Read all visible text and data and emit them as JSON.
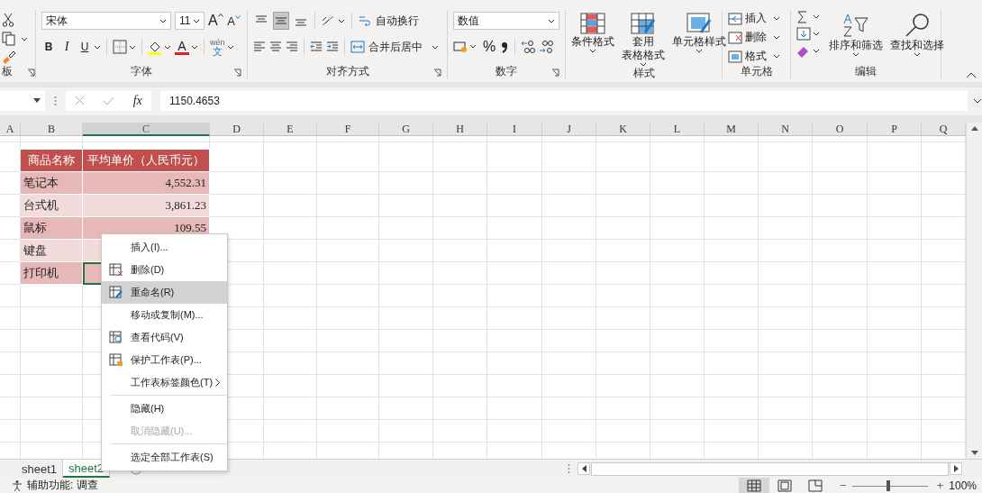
{
  "ribbon": {
    "clipboard": {
      "label": "板",
      "launcher": true
    },
    "font": {
      "label": "字体",
      "launcher": true,
      "font_name": "宋体",
      "font_size": "11",
      "grow": "A",
      "shrink": "A",
      "bold": "B",
      "italic": "I",
      "underline": "U",
      "font_color": "A",
      "phonetic_top": "wén",
      "phonetic_bottom": "文"
    },
    "alignment": {
      "label": "对齐方式",
      "launcher": true,
      "wrap_text": "自动换行",
      "merge_center": "合并后居中",
      "vertical": [
        {
          "selected": false
        },
        {
          "selected": true
        },
        {
          "selected": false
        }
      ]
    },
    "number": {
      "label": "数字",
      "launcher": true,
      "format": "数值",
      "percent": "%"
    },
    "styles": {
      "label": "样式",
      "buttons": [
        {
          "lines": [
            "条件格式"
          ]
        },
        {
          "lines": [
            "套用",
            "表格格式"
          ]
        },
        {
          "lines": [
            "单元格样式"
          ]
        }
      ]
    },
    "cells": {
      "label": "单元格",
      "buttons": [
        {
          "label": "插入"
        },
        {
          "label": "删除"
        },
        {
          "label": "格式"
        }
      ]
    },
    "editing": {
      "label": "编辑",
      "buttons": [
        {
          "label": "排序和筛选"
        },
        {
          "label": "查找和选择"
        }
      ]
    }
  },
  "formula_bar": {
    "fx": "fx",
    "value": "1150.4653"
  },
  "sheet": {
    "columns": [
      {
        "label": "A",
        "selected": false
      },
      {
        "label": "B",
        "selected": false
      },
      {
        "label": "C",
        "selected": true
      },
      {
        "label": "D",
        "selected": false
      },
      {
        "label": "E",
        "selected": false
      },
      {
        "label": "F",
        "selected": false
      },
      {
        "label": "G",
        "selected": false
      },
      {
        "label": "H",
        "selected": false
      },
      {
        "label": "I",
        "selected": false
      },
      {
        "label": "J",
        "selected": false
      },
      {
        "label": "K",
        "selected": false
      },
      {
        "label": "L",
        "selected": false
      },
      {
        "label": "M",
        "selected": false
      },
      {
        "label": "N",
        "selected": false
      },
      {
        "label": "O",
        "selected": false
      },
      {
        "label": "P",
        "selected": false
      },
      {
        "label": "Q",
        "selected": false
      }
    ],
    "table": {
      "header": [
        "商品名称",
        "平均单价（人民币元）"
      ],
      "rows": [
        {
          "name": "笔记本",
          "price": "4,552.31",
          "color": "#e6b8b7",
          "selected": false
        },
        {
          "name": "台式机",
          "price": "3,861.23",
          "color": "#f2dcdb",
          "selected": false
        },
        {
          "name": "鼠标",
          "price": "109.55",
          "color": "#e6b8b7",
          "selected": false
        },
        {
          "name": "键盘",
          "color": "#f2dcdb",
          "selected": false
        },
        {
          "name": "打印机",
          "color": "#e6b8b7",
          "selected": true
        }
      ]
    }
  },
  "context_menu": [
    {
      "label": "插入(I)...",
      "kind": "text",
      "selected": false,
      "disabled": false,
      "submenu": false,
      "separator_before": false
    },
    {
      "label": "删除(D)",
      "kind": "delete",
      "selected": false,
      "disabled": false,
      "submenu": false,
      "separator_before": false
    },
    {
      "label": "重命名(R)",
      "kind": "rename",
      "selected": true,
      "disabled": false,
      "submenu": false,
      "separator_before": false
    },
    {
      "label": "移动或复制(M)...",
      "kind": "text",
      "selected": false,
      "disabled": false,
      "submenu": false,
      "separator_before": false
    },
    {
      "label": "查看代码(V)",
      "kind": "view-code",
      "selected": false,
      "disabled": false,
      "submenu": false,
      "separator_before": false
    },
    {
      "label": "保护工作表(P)...",
      "kind": "protect",
      "selected": false,
      "disabled": false,
      "submenu": false,
      "separator_before": false
    },
    {
      "label": "工作表标签颜色(T)",
      "kind": "text",
      "selected": false,
      "disabled": false,
      "submenu": true,
      "separator_before": false
    },
    {
      "label": "隐藏(H)",
      "kind": "text",
      "selected": false,
      "disabled": false,
      "submenu": false,
      "separator_before": true
    },
    {
      "label": "取消隐藏(U)...",
      "kind": "text",
      "selected": false,
      "disabled": true,
      "submenu": false,
      "separator_before": false
    },
    {
      "label": "选定全部工作表(S)",
      "kind": "text",
      "selected": false,
      "disabled": false,
      "submenu": false,
      "separator_before": true
    }
  ],
  "sheet_tabs": [
    {
      "label": "sheet1",
      "selected": false
    },
    {
      "label": "sheet2",
      "selected": true
    }
  ],
  "status_bar": {
    "accessibility": "辅助功能: 调查",
    "views": [
      {
        "kind": "normal",
        "selected": true
      },
      {
        "kind": "page-layout",
        "selected": false
      },
      {
        "kind": "page-break",
        "selected": false
      }
    ],
    "zoom_out": "−",
    "zoom_in": "+",
    "zoom": {
      "level": 0.45,
      "label": "100%"
    }
  }
}
